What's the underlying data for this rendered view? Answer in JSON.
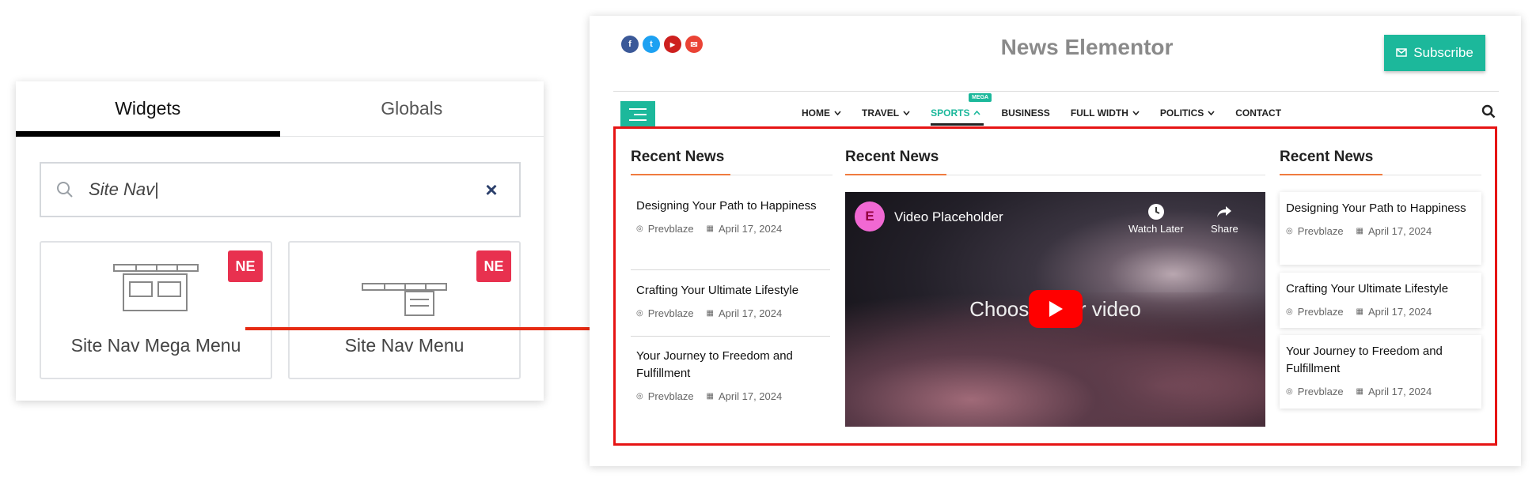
{
  "editor": {
    "tabs": [
      "Widgets",
      "Globals"
    ],
    "search_value": "Site Nav",
    "clear_symbol": "×",
    "widgets": [
      {
        "label": "Site Nav Mega Menu",
        "badge": "NE"
      },
      {
        "label": "Site Nav Menu",
        "badge": "NE"
      }
    ]
  },
  "site": {
    "title": "News Elementor",
    "subscribe_label": "Subscribe",
    "socials": [
      {
        "icon": "facebook-icon",
        "glyph": "f",
        "color": "#3b5998"
      },
      {
        "icon": "twitter-icon",
        "glyph": "t",
        "color": "#1da1f2"
      },
      {
        "icon": "youtube-icon",
        "glyph": "▶",
        "color": "#cd201f"
      },
      {
        "icon": "email-icon",
        "glyph": "✉",
        "color": "#ea4335"
      }
    ],
    "nav": [
      {
        "label": "HOME",
        "caret": "down"
      },
      {
        "label": "TRAVEL",
        "caret": "down"
      },
      {
        "label": "SPORTS",
        "caret": "up",
        "active": true,
        "tag": "MEGA"
      },
      {
        "label": "BUSINESS",
        "caret": ""
      },
      {
        "label": "FULL WIDTH",
        "caret": "down"
      },
      {
        "label": "POLITICS",
        "caret": "down"
      },
      {
        "label": "CONTACT",
        "caret": ""
      }
    ],
    "accent": "#1cb89b",
    "mega": {
      "col1": {
        "heading": "Recent News",
        "posts": [
          {
            "title": "Designing Your Path to Happiness",
            "author": "Prevblaze",
            "date": "April 17, 2024"
          },
          {
            "title": "Crafting Your Ultimate Lifestyle",
            "author": "Prevblaze",
            "date": "April 17, 2024"
          },
          {
            "title": "Your Journey to Freedom and Fulfillment",
            "author": "Prevblaze",
            "date": "April 17, 2024"
          }
        ]
      },
      "col2": {
        "heading": "Recent News",
        "video": {
          "title": "Video Placeholder",
          "watch_later": "Watch Later",
          "share": "Share",
          "center_text": "Choose your video"
        }
      },
      "col3": {
        "heading": "Recent News",
        "posts": [
          {
            "title": "Designing Your Path to Happiness",
            "author": "Prevblaze",
            "date": "April 17, 2024"
          },
          {
            "title": "Crafting Your Ultimate Lifestyle",
            "author": "Prevblaze",
            "date": "April 17, 2024"
          },
          {
            "title": "Your Journey to Freedom and Fulfillment",
            "author": "Prevblaze",
            "date": "April 17, 2024"
          }
        ]
      }
    }
  }
}
